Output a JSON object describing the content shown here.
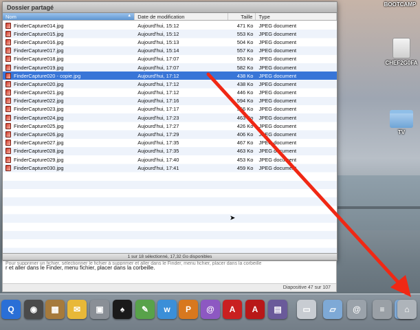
{
  "window": {
    "title": "Dossier partagé"
  },
  "columns": {
    "name": "Nom",
    "date": "Date de modification",
    "size": "Taille",
    "type": "Type"
  },
  "files": [
    {
      "name": "FinderCapture014.jpg",
      "date": "Aujourd'hui, 15:12",
      "size": "471 Ko",
      "type": "JPEG document"
    },
    {
      "name": "FinderCapture015.jpg",
      "date": "Aujourd'hui, 15:12",
      "size": "553 Ko",
      "type": "JPEG document"
    },
    {
      "name": "FinderCapture016.jpg",
      "date": "Aujourd'hui, 15:13",
      "size": "504 Ko",
      "type": "JPEG document"
    },
    {
      "name": "FinderCapture017.jpg",
      "date": "Aujourd'hui, 15:14",
      "size": "557 Ko",
      "type": "JPEG document"
    },
    {
      "name": "FinderCapture018.jpg",
      "date": "Aujourd'hui, 17:07",
      "size": "553 Ko",
      "type": "JPEG document"
    },
    {
      "name": "FinderCapture019.jpg",
      "date": "Aujourd'hui, 17:07",
      "size": "582 Ko",
      "type": "JPEG document"
    },
    {
      "name": "FinderCapture020 - copie.jpg",
      "date": "Aujourd'hui, 17:12",
      "size": "438 Ko",
      "type": "JPEG document",
      "selected": true
    },
    {
      "name": "FinderCapture020.jpg",
      "date": "Aujourd'hui, 17:12",
      "size": "438 Ko",
      "type": "JPEG document"
    },
    {
      "name": "FinderCapture021.jpg",
      "date": "Aujourd'hui, 17:12",
      "size": "446 Ko",
      "type": "JPEG document"
    },
    {
      "name": "FinderCapture022.jpg",
      "date": "Aujourd'hui, 17:16",
      "size": "594 Ko",
      "type": "JPEG document"
    },
    {
      "name": "FinderCapture023.jpg",
      "date": "Aujourd'hui, 17:17",
      "size": "566 Ko",
      "type": "JPEG document"
    },
    {
      "name": "FinderCapture024.jpg",
      "date": "Aujourd'hui, 17:23",
      "size": "463 Ko",
      "type": "JPEG document"
    },
    {
      "name": "FinderCapture025.jpg",
      "date": "Aujourd'hui, 17:27",
      "size": "426 Ko",
      "type": "JPEG document"
    },
    {
      "name": "FinderCapture026.jpg",
      "date": "Aujourd'hui, 17:29",
      "size": "406 Ko",
      "type": "JPEG document"
    },
    {
      "name": "FinderCapture027.jpg",
      "date": "Aujourd'hui, 17:35",
      "size": "467 Ko",
      "type": "JPEG document"
    },
    {
      "name": "FinderCapture028.jpg",
      "date": "Aujourd'hui, 17:35",
      "size": "463 Ko",
      "type": "JPEG document"
    },
    {
      "name": "FinderCapture029.jpg",
      "date": "Aujourd'hui, 17:40",
      "size": "453 Ko",
      "type": "JPEG document"
    },
    {
      "name": "FinderCapture030.jpg",
      "date": "Aujourd'hui, 17:41",
      "size": "459 Ko",
      "type": "JPEG document"
    }
  ],
  "status": {
    "text": "1 sur 18 sélectionné, 17,32 Go disponibles"
  },
  "notes": {
    "line1": "Pour supprimer un fichier, sélectionner le fichier à supprimer et aller dans le Finder, menu fichier, placer dans la corbeille",
    "line2": "r et aller dans le Finder, menu fichier, placer dans la corbeille.",
    "slide_counter": "Diapositive 47 sur 107"
  },
  "desktop": {
    "items": [
      {
        "label": "BOOTCAMP",
        "icon": "hard-drive-icon"
      },
      {
        "label": "CHEF2G0FA",
        "icon": "hard-drive-icon"
      },
      {
        "label": "TV",
        "icon": "folder-icon"
      }
    ]
  },
  "dock": {
    "items": [
      {
        "name": "quicktime-icon",
        "glyph": "Q",
        "color": "#2a6fd6"
      },
      {
        "name": "camera-icon",
        "glyph": "◉",
        "color": "#4a4a4a"
      },
      {
        "name": "photo-icon",
        "glyph": "▦",
        "color": "#a67a3c"
      },
      {
        "name": "postage-icon",
        "glyph": "✉",
        "color": "#e8b838"
      },
      {
        "name": "preview-icon",
        "glyph": "▣",
        "color": "#8a8f96"
      },
      {
        "name": "spade-icon",
        "glyph": "♠",
        "color": "#1a1a1a"
      },
      {
        "name": "image-edit-icon",
        "glyph": "✎",
        "color": "#58a24a"
      },
      {
        "name": "w-app-icon",
        "glyph": "w",
        "color": "#3b8fd8"
      },
      {
        "name": "p-app-icon",
        "glyph": "P",
        "color": "#d8781e"
      },
      {
        "name": "spiral-app-icon",
        "glyph": "@",
        "color": "#8d58c2"
      },
      {
        "name": "acrobat-icon",
        "glyph": "A",
        "color": "#c92020"
      },
      {
        "name": "acrobat-reader-icon",
        "glyph": "A",
        "color": "#b81818"
      },
      {
        "name": "media-app-icon",
        "glyph": "▤",
        "color": "#6a5a9a"
      },
      {
        "name": "document-stack-icon",
        "glyph": "▭",
        "color": "#c8ccd2"
      },
      {
        "name": "folder-stack-icon",
        "glyph": "▱",
        "color": "#7ea9d6"
      },
      {
        "name": "at-sign-icon",
        "glyph": "@",
        "color": "#9aa2aa"
      },
      {
        "name": "coin-stack-icon",
        "glyph": "≡",
        "color": "#9aa0a6"
      },
      {
        "name": "downloads-folder-icon",
        "glyph": "▱",
        "color": "#7ea9d6"
      },
      {
        "name": "trash-icon",
        "glyph": "⌂",
        "color": "#aeb4ba"
      }
    ]
  }
}
